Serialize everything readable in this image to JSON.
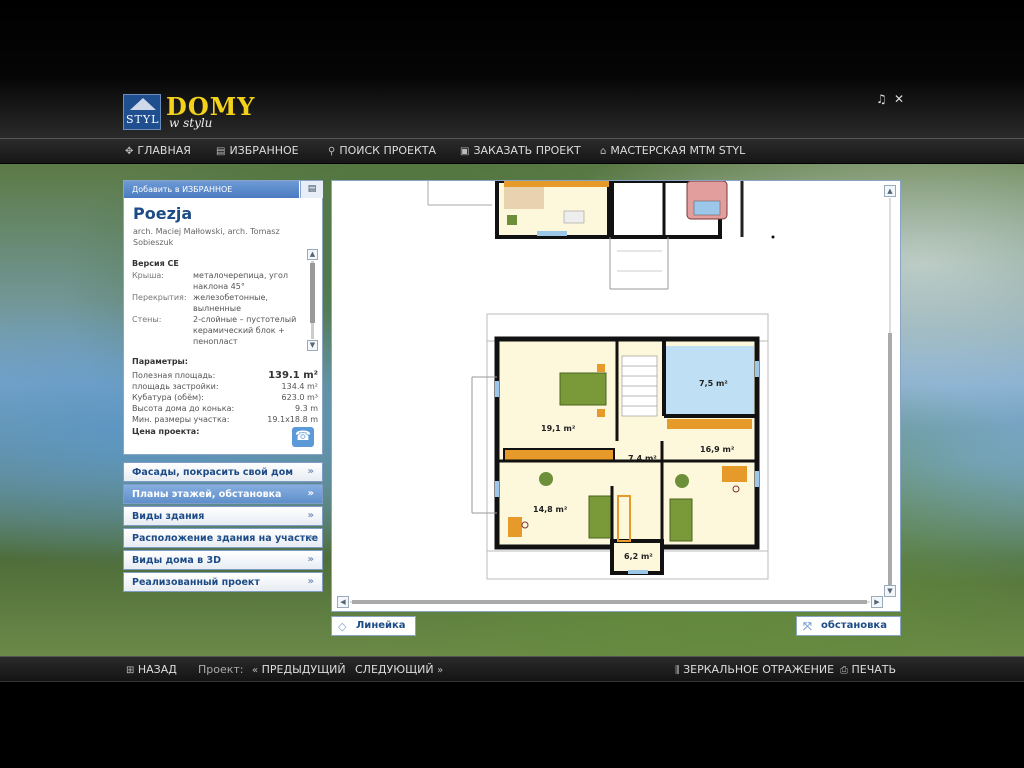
{
  "header": {
    "logo_box_text": "STYL",
    "logo_title": "DOMY",
    "logo_subtitle": "w stylu",
    "music_glyph": "♫",
    "close_glyph": "✕"
  },
  "main_nav": [
    {
      "id": "home",
      "label": "ГЛАВНАЯ",
      "icon": "move-icon",
      "glyph": "✥"
    },
    {
      "id": "favorites",
      "label": "ИЗБРАННОЕ",
      "icon": "favorites-icon",
      "glyph": "▤"
    },
    {
      "id": "search",
      "label": "ПОИСК ПРОЕКТА",
      "icon": "search-icon",
      "glyph": "⚲"
    },
    {
      "id": "order",
      "label": "ЗАКАЗАТЬ ПРОЕКТ",
      "icon": "order-icon",
      "glyph": "▣"
    },
    {
      "id": "workshop",
      "label": "МАСТЕРСКАЯ MTM STYL",
      "icon": "roof-icon",
      "glyph": "⌂"
    }
  ],
  "project": {
    "add_to_favorites": "Добавить в ИЗБРАННОЕ",
    "name": "Poezja",
    "architects": "arch. Maciej Małłowski, arch. Tomasz Sobieszuk",
    "version": "Версия CE",
    "specs": [
      {
        "key": "Крыша:",
        "value": "металочерепица, угол наклона 45°"
      },
      {
        "key": "Перекрытия:",
        "value": "железобетонные, вылнeнные"
      },
      {
        "key": "Стены:",
        "value": "2-слойные – пустотелый керамический блок + пенопласт"
      }
    ],
    "params_title": "Параметры:",
    "params": [
      {
        "key": "Полезная площадь:",
        "value": "139.1 m²"
      },
      {
        "key": "площадь застройки:",
        "value": "134.4 m²"
      },
      {
        "key": "Кубатура (обём):",
        "value": "623.0 m³"
      },
      {
        "key": "Высота дома до конька:",
        "value": "9.3 m"
      },
      {
        "key": "Мин. размеры участка:",
        "value": "19.1x18.8 m"
      }
    ],
    "price_label": "Цена проекта:",
    "phone_glyph": "☎"
  },
  "menu": [
    {
      "label": "Фасады, покрасить свой дом",
      "active": false
    },
    {
      "label": "Планы этажей, обстановка",
      "active": true
    },
    {
      "label": "Виды здания",
      "active": false
    },
    {
      "label": "Расположение здания на участке",
      "active": false
    },
    {
      "label": "Виды дома в 3D",
      "active": false
    },
    {
      "label": "Реализованный проект",
      "active": false
    }
  ],
  "menu_arrow": "»",
  "plan": {
    "rooms": [
      "7,5 m²",
      "19,1 m²",
      "7,4 m²",
      "16,9 m²",
      "14,8 m²",
      "6,2 m²"
    ]
  },
  "viewer": {
    "ruler_label": "Линейка",
    "ruler_glyph": "◇",
    "furniture_label": "обстановка",
    "furniture_glyph": "⤧",
    "scroll_up": "▲",
    "scroll_down": "▼",
    "scroll_left": "◀",
    "scroll_right": "▶"
  },
  "bottom_nav": {
    "back_label": "НАЗАД",
    "back_glyph": "⊞",
    "project_label": "Проект:",
    "prev_label": "ПРЕДЫДУЩИЙ",
    "prev_glyph": "«",
    "next_label": "СЛЕДУЮЩИЙ",
    "next_glyph": "»",
    "mirror_label": "ЗЕРКАЛЬНОЕ ОТРАЖЕНИЕ",
    "mirror_glyph": "⫼",
    "print_label": "ПЕЧАТЬ",
    "print_glyph": "⎙"
  },
  "colors": {
    "accent_blue": "#1d4b86",
    "logo_yellow": "#f4d21a",
    "active_menu": "#5f8fcb"
  }
}
